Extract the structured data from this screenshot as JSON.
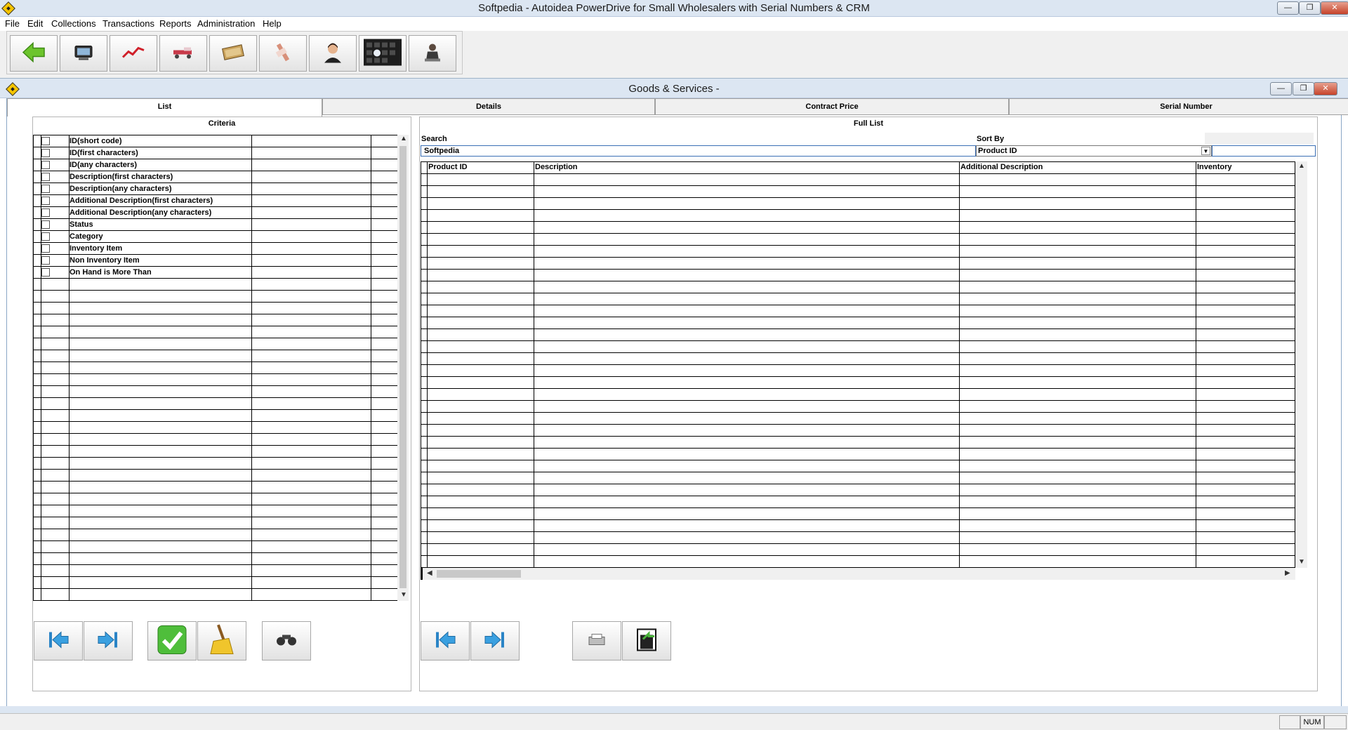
{
  "window": {
    "title": "Softpedia - Autoidea PowerDrive for Small Wholesalers with Serial Numbers & CRM",
    "controls": [
      "minimize",
      "restore",
      "close"
    ]
  },
  "menu": [
    "File",
    "Edit",
    "Collections",
    "Transactions",
    "Reports",
    "Administration",
    "Help"
  ],
  "toolbar": [
    {
      "name": "back",
      "icon": "green-arrow-left-icon"
    },
    {
      "name": "pos-terminal",
      "icon": "pos-terminal-icon"
    },
    {
      "name": "sales-chart",
      "icon": "trend-chart-icon"
    },
    {
      "name": "delivery",
      "icon": "delivery-truck-icon"
    },
    {
      "name": "money",
      "icon": "money-icon"
    },
    {
      "name": "tools",
      "icon": "tools-icon"
    },
    {
      "name": "contact",
      "icon": "customer-service-icon"
    },
    {
      "name": "keyboard",
      "icon": "keyboard-icon"
    },
    {
      "name": "employee",
      "icon": "employee-icon"
    }
  ],
  "child": {
    "title": "Goods & Services -",
    "tabs": [
      "List",
      "Details",
      "Contract Price",
      "Serial Number"
    ],
    "active_tab": "List"
  },
  "criteria": {
    "header": "Criteria",
    "items": [
      "ID(short code)",
      "ID(first characters)",
      "ID(any characters)",
      "Description(first characters)",
      "Description(any characters)",
      "Additional Description(first characters)",
      "Additional Description(any characters)",
      "Status",
      "Category",
      "Inventory Item",
      "Non Inventory Item",
      "On Hand is More Than"
    ],
    "buttons": [
      {
        "name": "prev",
        "icon": "arrow-left-icon"
      },
      {
        "name": "next",
        "icon": "arrow-right-icon"
      },
      {
        "name": "apply",
        "icon": "checkmark-icon"
      },
      {
        "name": "clear",
        "icon": "broom-icon"
      },
      {
        "name": "find",
        "icon": "binoculars-icon"
      }
    ]
  },
  "fulllist": {
    "header": "Full List",
    "search_label": "Search",
    "search_value": "Softpedia",
    "sort_label": "Sort By",
    "sort_value": "Product ID",
    "columns": [
      "Product ID",
      "Description",
      "Additional Description",
      "Inventory"
    ],
    "buttons": [
      {
        "name": "prev",
        "icon": "arrow-left-icon"
      },
      {
        "name": "next",
        "icon": "arrow-right-icon"
      },
      {
        "name": "print",
        "icon": "printer-icon"
      },
      {
        "name": "export",
        "icon": "export-icon"
      }
    ]
  },
  "statusbar": {
    "num": "NUM"
  }
}
